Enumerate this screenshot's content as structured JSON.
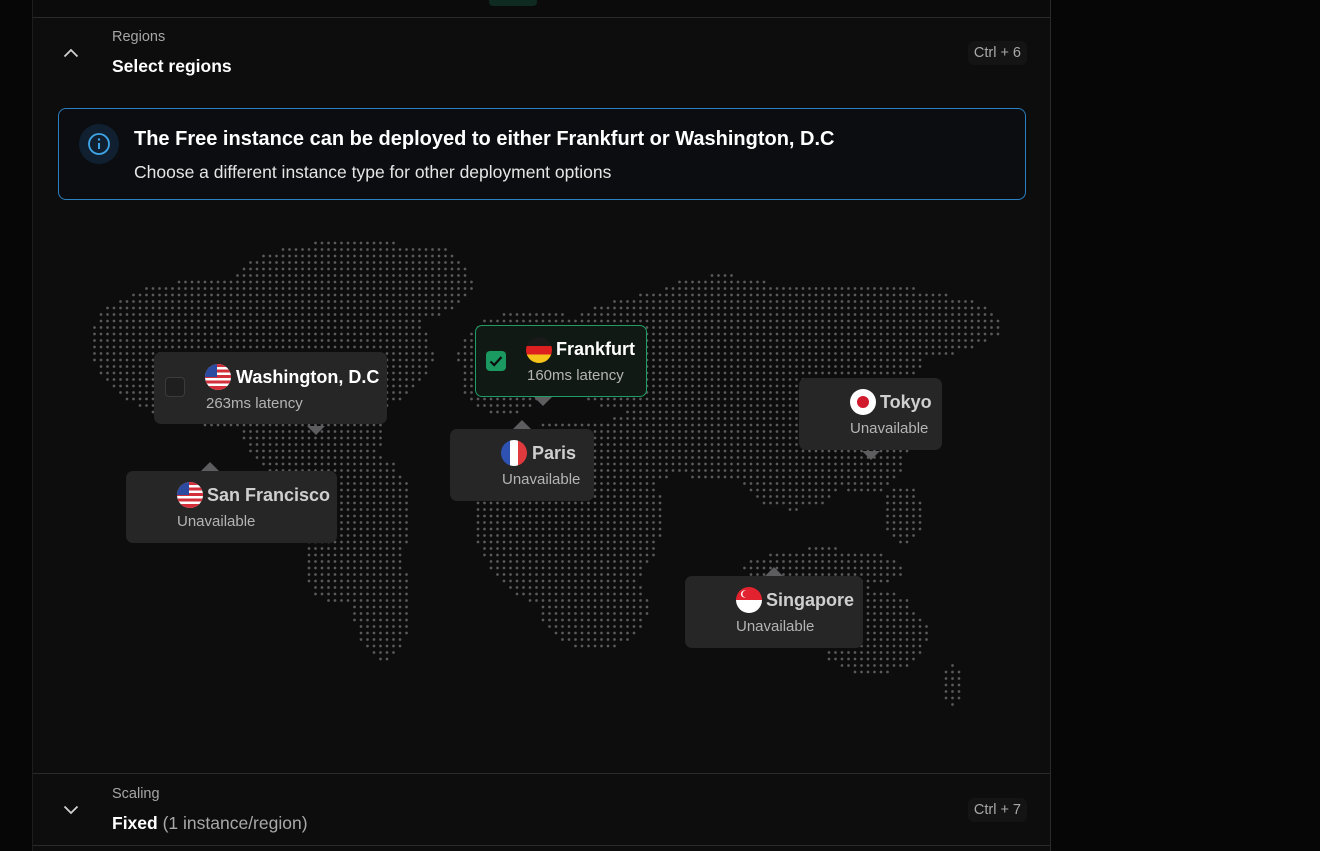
{
  "regions_section": {
    "label": "Regions",
    "value": "Select regions",
    "shortcut": "Ctrl + 6"
  },
  "info": {
    "title": "The Free instance can be deployed to either Frankfurt or Washington, D.C",
    "subtitle": "Choose a different instance type for other deployment options",
    "icon": "info-icon"
  },
  "regions": [
    {
      "name": "Washington, D.C",
      "status": "263ms latency",
      "selected": false,
      "available": true,
      "flag": "us"
    },
    {
      "name": "Frankfurt",
      "status": "160ms latency",
      "selected": true,
      "available": true,
      "flag": "de"
    },
    {
      "name": "Paris",
      "status": "Unavailable",
      "selected": false,
      "available": false,
      "flag": "fr"
    },
    {
      "name": "San Francisco",
      "status": "Unavailable",
      "selected": false,
      "available": false,
      "flag": "us"
    },
    {
      "name": "Tokyo",
      "status": "Unavailable",
      "selected": false,
      "available": false,
      "flag": "jp"
    },
    {
      "name": "Singapore",
      "status": "Unavailable",
      "selected": false,
      "available": false,
      "flag": "sg"
    }
  ],
  "scaling_section": {
    "label": "Scaling",
    "value": "Fixed",
    "value_detail": "(1 instance/region)",
    "shortcut": "Ctrl + 7"
  },
  "colors": {
    "accent_green": "#1a9a61",
    "info_border": "#2c7fc0",
    "info_icon": "#3ea6e8"
  }
}
